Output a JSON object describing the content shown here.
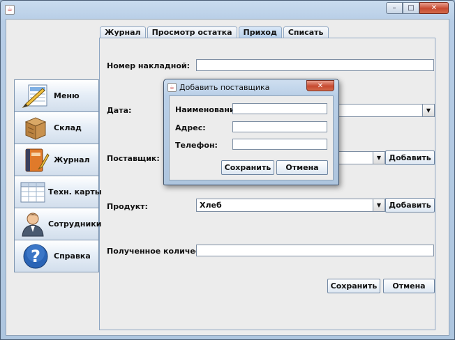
{
  "window": {
    "controls": {
      "minimize": "–",
      "maximize": "□",
      "close": "✕"
    }
  },
  "tabs": [
    {
      "label": "Журнал",
      "active": false
    },
    {
      "label": "Просмотр остатка",
      "active": false
    },
    {
      "label": "Приход",
      "active": true
    },
    {
      "label": "Списать",
      "active": false
    }
  ],
  "sidebar": {
    "items": [
      {
        "label": "Меню",
        "icon": "pencil-ruler-icon"
      },
      {
        "label": "Склад",
        "icon": "box-icon"
      },
      {
        "label": "Журнал",
        "icon": "book-icon"
      },
      {
        "label": "Техн. карты",
        "icon": "spreadsheet-icon"
      },
      {
        "label": "Сотрудники",
        "icon": "person-icon"
      },
      {
        "label": "Справка",
        "icon": "help-icon"
      }
    ]
  },
  "form": {
    "invoice_label": "Номер накладной:",
    "invoice_value": "",
    "date_label": "Дата:",
    "supplier_label": "Поставщик:",
    "supplier_add": "Добавить",
    "product_label": "Продукт:",
    "product_value": "Хлеб",
    "product_add": "Добавить",
    "quantity_label": "Полученное количество:",
    "quantity_value": "",
    "save": "Сохранить",
    "cancel": "Отмена"
  },
  "dialog": {
    "title": "Добавить поставщика",
    "name_label": "Наименование:",
    "address_label": "Адрес:",
    "phone_label": "Телефон:",
    "save": "Сохранить",
    "cancel": "Отмена"
  }
}
